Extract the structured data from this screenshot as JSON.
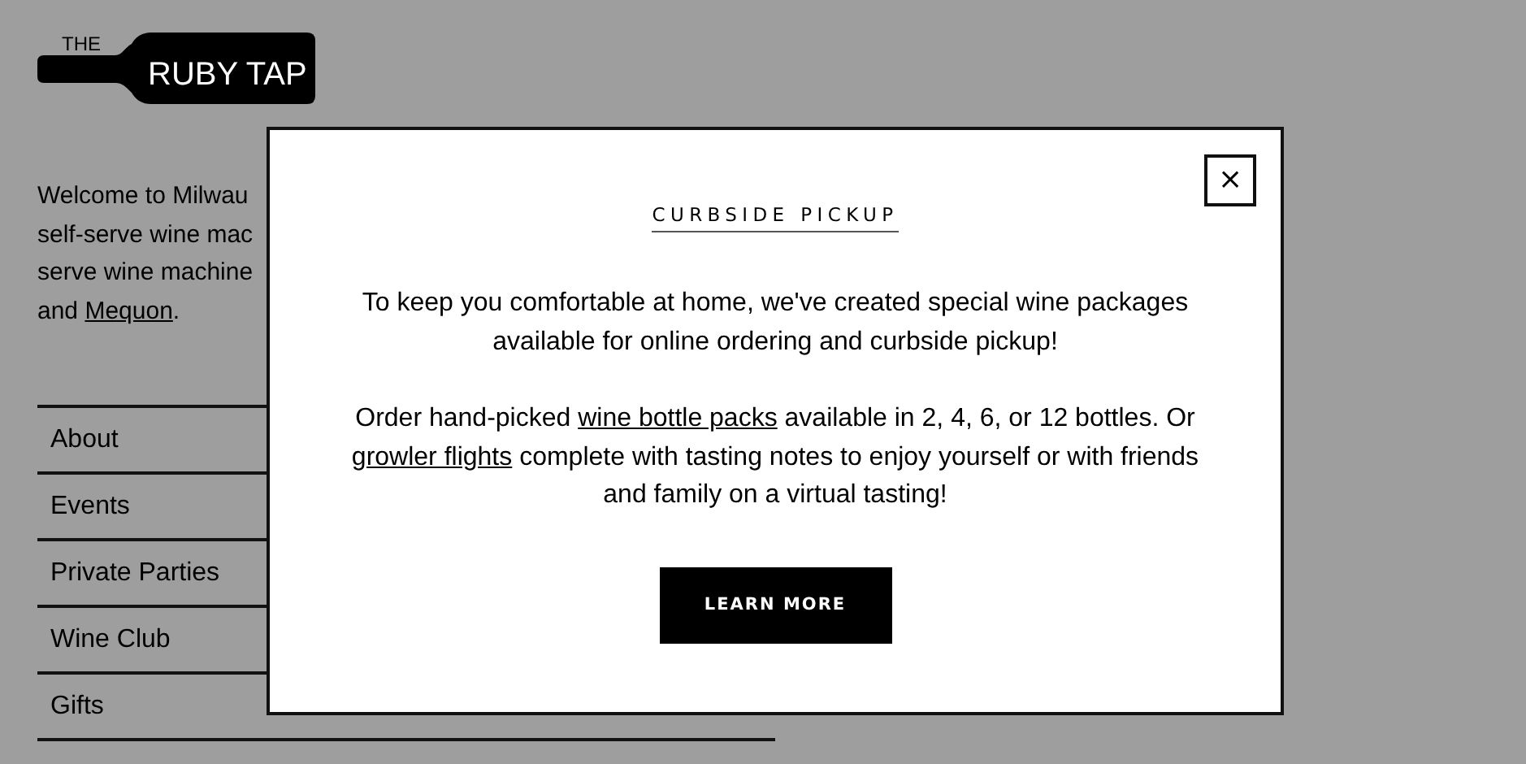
{
  "logo": {
    "small": "THE",
    "name": "RUBY TAP"
  },
  "intro": [
    [
      {
        "kind": "text",
        "text": "Welcome to Milwau"
      }
    ],
    [
      {
        "kind": "text",
        "text": "self-serve wine mac"
      }
    ],
    [
      {
        "kind": "text",
        "text": "serve wine machine"
      }
    ],
    [
      {
        "kind": "text",
        "text": "and "
      },
      {
        "kind": "link",
        "text": "Mequon"
      },
      {
        "kind": "text",
        "text": "."
      }
    ]
  ],
  "nav": [
    "About",
    "Events",
    "Private Parties",
    "Wine Club",
    "Gifts"
  ],
  "modal": {
    "close": "×",
    "title": "CURBSIDE PICKUP",
    "paragraphs": [
      [
        {
          "kind": "text",
          "text": "To keep you comfortable at home, we've created special wine packages available for online ordering and curbside pickup!"
        }
      ],
      [
        {
          "kind": "text",
          "text": "Order hand-picked "
        },
        {
          "kind": "link",
          "text": "wine bottle packs"
        },
        {
          "kind": "text",
          "text": " available in 2, 4, 6, or 12 bottles. Or "
        },
        {
          "kind": "link",
          "text": "growler flights"
        },
        {
          "kind": "text",
          "text": " complete with tasting notes to enjoy yourself or with friends and family on a virtual tasting!"
        }
      ]
    ],
    "button": "LEARN MORE"
  }
}
